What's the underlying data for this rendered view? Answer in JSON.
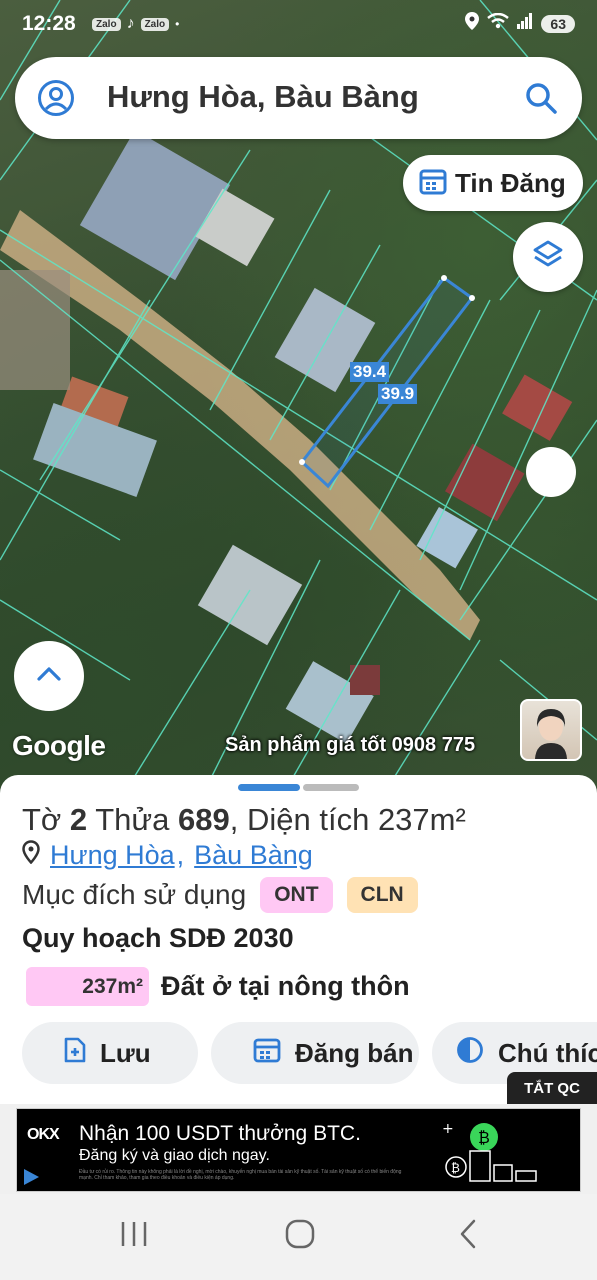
{
  "status": {
    "time": "12:28",
    "apps": [
      "Zalo",
      "♪",
      "Zalo"
    ],
    "battery": "63"
  },
  "search": {
    "query": "Hưng Hòa, Bàu Bàng"
  },
  "map": {
    "tin_dang_label": "Tin Đăng",
    "dim_a": "39.4",
    "dim_b": "39.9",
    "google": "Google",
    "promo": "Sản phẩm giá tốt 0908 775"
  },
  "parcel": {
    "to_label": "Tờ",
    "to_value": "2",
    "thua_label": "Thửa",
    "thua_value": "689",
    "area_label": "Diện tích",
    "area_value": "237m²",
    "ward": "Hưng Hòa",
    "district": "Bàu Bàng",
    "purpose_label": "Mục đích sử dụng",
    "purpose_codes": [
      "ONT",
      "CLN"
    ],
    "plan_title": "Quy hoạch SDĐ 2030",
    "plan_area": "237m²",
    "plan_desc": "Đất ở tại nông thôn"
  },
  "actions": {
    "save": "Lưu",
    "sell": "Đăng bán",
    "note": "Chú thích"
  },
  "ad": {
    "hide": "TẮT QC",
    "brand": "OKX",
    "title": "Nhận 100 USDT thưởng BTC.",
    "subtitle": "Đăng ký và giao dịch ngay.",
    "fine_print": "Đầu tư có rủi ro. Thông tin này không phải là lời đề nghị, mời chào, khuyến nghị mua bán tài sản kỹ thuật số. Tài sản kỹ thuật số có thể biến động mạnh. Chỉ tham khảo, tham gia theo điều khoản và điều kiện áp dụng."
  },
  "colors": {
    "accent": "#2f7bd4",
    "parcel_line": "#3a86d6",
    "chip_ont": "#ffc8f4",
    "chip_cln": "#ffe2b4"
  }
}
